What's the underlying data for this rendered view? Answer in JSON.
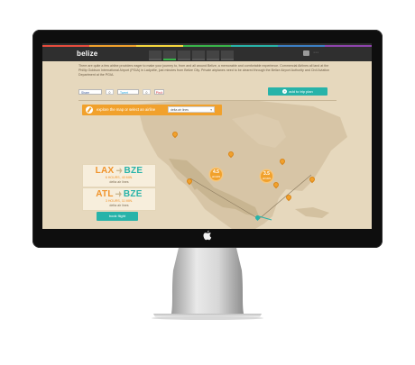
{
  "site": {
    "logo": "belize",
    "nav_tabs": 6,
    "active_tab": 2
  },
  "colors": {
    "accent_teal": "#27b3a9",
    "accent_orange": "#f1a12c",
    "map_background": "#e6d8bd",
    "topbar": "#2f2f2f",
    "stripes": [
      "#e84c3d",
      "#f1a12c",
      "#f5d63d",
      "#38b449",
      "#27b3a9",
      "#3b7fc4",
      "#8e44ad"
    ]
  },
  "intro": {
    "text": "There are quite a few airline providers eager to make your journey to, from and all around Belize, a memorable and comfortable experience. Commercial Airlines all land at the Phillip Goldson International Airport (PGIA) in Ladyville, just minutes from Belize City. Private airplanes need to be cleared through the Belize Airport Authority and Civil Aviation Department at the PGIA."
  },
  "share": {
    "facebook_label": "Share",
    "facebook_count": "0",
    "tweet_label": "Tweet",
    "tweet_count": "0",
    "pin_label": "Pin it"
  },
  "add_to_trip_label": "add to trip plan",
  "explore": {
    "label": "explore the map or select an airline",
    "select_value": "delta air lines"
  },
  "routes": [
    {
      "from": "LAX",
      "to": "BZE",
      "duration": "6 HOURS, 40 MIN.",
      "airline": "delta air lines"
    },
    {
      "from": "ATL",
      "to": "BZE",
      "duration": "3 HOURS, 11 MIN.",
      "airline": "delta air lines"
    }
  ],
  "book_label": "book flight",
  "map_badges": [
    {
      "value": "4.5",
      "unit": "HOURS"
    },
    {
      "value": "3.5",
      "unit": "HOURS"
    }
  ]
}
